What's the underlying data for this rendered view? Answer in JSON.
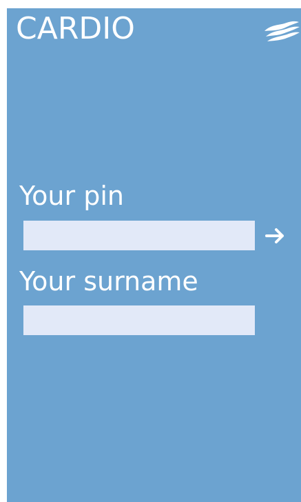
{
  "app": {
    "title": "CARDIO",
    "logo_icon": "waves-logo-icon"
  },
  "login": {
    "pin_label": "Your pin",
    "pin_value": "",
    "pin_placeholder": "",
    "surname_label": "Your surname",
    "surname_value": "",
    "surname_placeholder": "",
    "submit_icon": "arrow-right-icon"
  },
  "colors": {
    "background": "#6ca3d0",
    "input_fill": "#e2e9f8",
    "text": "#ffffff"
  }
}
